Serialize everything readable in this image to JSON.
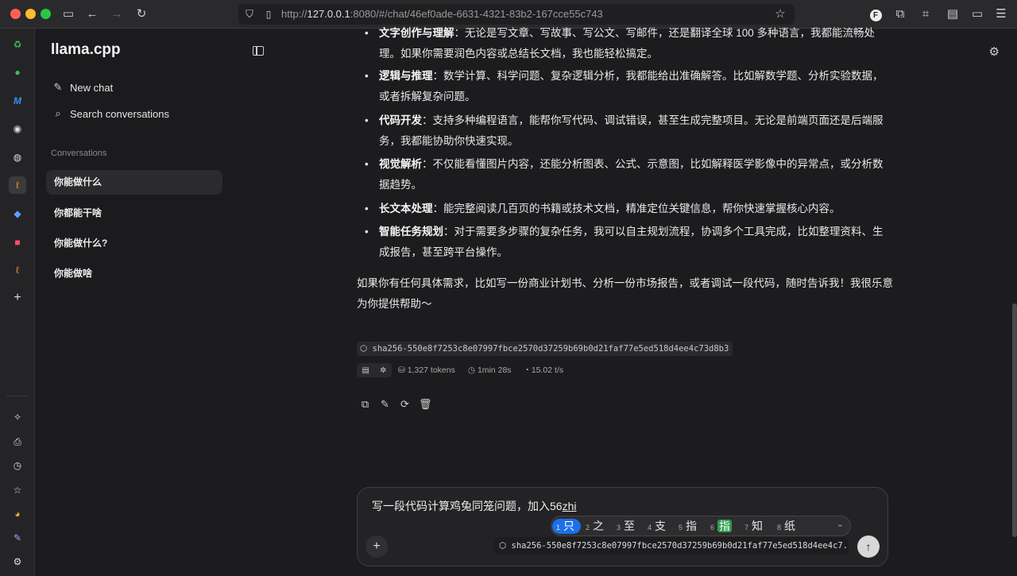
{
  "browser": {
    "url_prefix": "http://",
    "url_host": "127.0.0.1",
    "url_rest": ":8080/#/chat/46ef0ade-6631-4321-83b2-167cce55c743"
  },
  "sidebar": {
    "brand": "llama.cpp",
    "new_chat": "New chat",
    "search": "Search conversations",
    "section_label": "Conversations",
    "conversations": [
      {
        "label": "你能做什么"
      },
      {
        "label": "你都能干啥"
      },
      {
        "label": "你能做什么?"
      },
      {
        "label": "你能做啥"
      }
    ]
  },
  "message": {
    "bullets": [
      {
        "title": "文字创作与理解",
        "text": "：无论是写文章、写故事、写公文、写邮件，还是翻译全球 100 多种语言，我都能流畅处理。如果你需要润色内容或总结长文档，我也能轻松搞定。"
      },
      {
        "title": "逻辑与推理",
        "text": "：数学计算、科学问题、复杂逻辑分析，我都能给出准确解答。比如解数学题、分析实验数据，或者拆解复杂问题。"
      },
      {
        "title": "代码开发",
        "text": "：支持多种编程语言，能帮你写代码、调试错误，甚至生成完整项目。无论是前端页面还是后端服务，我都能协助你快速实现。"
      },
      {
        "title": "视觉解析",
        "text": "：不仅能看懂图片内容，还能分析图表、公式、示意图，比如解释医学影像中的异常点，或分析数据趋势。"
      },
      {
        "title": "长文本处理",
        "text": "：能完整阅读几百页的书籍或技术文档，精准定位关键信息，帮你快速掌握核心内容。"
      },
      {
        "title": "智能任务规划",
        "text": "：对于需要多步骤的复杂任务，我可以自主规划流程，协调多个工具完成，比如整理资料、生成报告，甚至跨平台操作。"
      }
    ],
    "closing": "如果你有任何具体需求，比如写一份商业计划书、分析一份市场报告，或者调试一段代码，随时告诉我！我很乐意为你提供帮助～",
    "model": "sha256-550e8f7253c8e07997fbce2570d37259b69b0d21faf77e5ed518d4ee4c73d8b3",
    "tokens": "1,327 tokens",
    "duration": "1min 28s",
    "speed": "15.02 t/s"
  },
  "composer": {
    "text": "写一段代码计算鸡兔同笼问题，加入56",
    "pending": "zhi",
    "candidates": [
      {
        "n": "1",
        "c": "只"
      },
      {
        "n": "2",
        "c": "之"
      },
      {
        "n": "3",
        "c": "至"
      },
      {
        "n": "4",
        "c": "支"
      },
      {
        "n": "5",
        "c": "指"
      },
      {
        "n": "6",
        "c": "指"
      },
      {
        "n": "7",
        "c": "知"
      },
      {
        "n": "8",
        "c": "纸"
      }
    ],
    "model": "sha256-550e8f7253c8e07997fbce2570d37259b69b0d21faf77e5ed518d4ee4c7..."
  }
}
